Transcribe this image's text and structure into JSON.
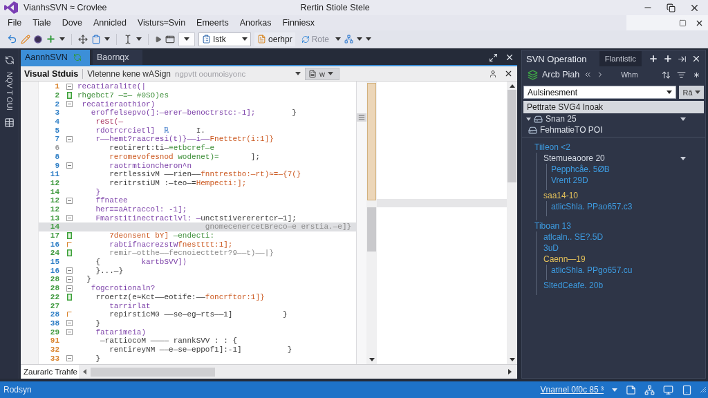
{
  "window": {
    "title": "VianhsSVN ≈ Crovlee",
    "caption": "Rertin Stiole Stele"
  },
  "menu": [
    "File",
    "Tiale",
    "Dove",
    "Annicled",
    "Visturs≈Svin",
    "Emeerts",
    "Anorkas",
    "Finniesx"
  ],
  "toolbar": {
    "combo": "Istk",
    "buttons": [
      {
        "label": "oerhpr",
        "disabled": false
      },
      {
        "label": "Rote",
        "disabled": true
      }
    ]
  },
  "side_strip": {
    "label": "NQV T OUI"
  },
  "document_tabs": [
    {
      "label": "AannhSVN",
      "selected": true
    },
    {
      "label": "Baornqx",
      "selected": false
    }
  ],
  "editor": {
    "title": "Visual Stduis",
    "path": "Vletenne kene wASign",
    "note": "ngpvtt ooumoisyonc",
    "button": "w",
    "bottom_tab": "Zaurarlc Trahfe",
    "lines": [
      {
        "number": "1",
        "color": "#d9822b",
        "kind": "fold",
        "highlighted": false,
        "segments": [
          {
            "text": "recatiaralite(|",
            "kind": "keyword"
          }
        ]
      },
      {
        "number": "2",
        "color": "#3f9a3f",
        "kind": "change",
        "highlighted": false,
        "segments": [
          {
            "text": "rhgebct7 —≡— #0SO)es",
            "kind": "comment"
          }
        ]
      },
      {
        "number": "2",
        "color": "#2f7fc6",
        "kind": "fold",
        "highlighted": false,
        "segments": [
          {
            "text": " recatieraothior)",
            "kind": "keyword"
          }
        ]
      },
      {
        "number": "3",
        "color": "#2f7fc6",
        "kind": "plain",
        "highlighted": false,
        "segments": [
          {
            "text": "   eroffelsepvo(]:—erer—benoctrstc:-1];",
            "kind": "keyword"
          },
          {
            "text": "        }",
            "kind": "plain"
          }
        ]
      },
      {
        "number": "4",
        "color": "#2f7fc6",
        "kind": "plain",
        "highlighted": false,
        "segments": [
          {
            "text": "    reSt(—",
            "kind": "accent"
          }
        ]
      },
      {
        "number": "5",
        "color": "#2f7fc6",
        "kind": "plain",
        "highlighted": false,
        "segments": [
          {
            "text": "    rdotrcrcietl]",
            "kind": "keyword"
          },
          {
            "text": "  ℝ",
            "kind": "symbol"
          },
          {
            "text": "      I.",
            "kind": "plain"
          }
        ]
      },
      {
        "number": "7",
        "color": "#2f7fc6",
        "kind": "fold",
        "highlighted": false,
        "segments": [
          {
            "text": "    r——hemt?raacresi(t)}——i——",
            "kind": "keyword"
          },
          {
            "text": "Fnettetr(i:1]}",
            "kind": "string"
          }
        ]
      },
      {
        "number": "6",
        "color": "#9a9a9a",
        "kind": "plain",
        "highlighted": false,
        "segments": [
          {
            "text": "       reotirert:ti—",
            "kind": "plain"
          },
          {
            "text": "≡etbcref—e",
            "kind": "comment"
          }
        ]
      },
      {
        "number": "8",
        "color": "#2f7fc6",
        "kind": "plain",
        "highlighted": false,
        "segments": [
          {
            "text": "       reromevofesnod",
            "kind": "string"
          },
          {
            "text": " wodenet)=",
            "kind": "comment"
          },
          {
            "text": "       ];",
            "kind": "plain"
          }
        ]
      },
      {
        "number": "9",
        "color": "#2f7fc6",
        "kind": "fold",
        "highlighted": false,
        "segments": [
          {
            "text": "       raotrmtioncheron^n",
            "kind": "keyword"
          }
        ]
      },
      {
        "number": "11",
        "color": "#2f7fc6",
        "kind": "plain",
        "highlighted": false,
        "segments": [
          {
            "text": "       rertlessivM ——rien——",
            "kind": "plain"
          },
          {
            "text": "fnntrestbo:—rt)≈=—{7(}",
            "kind": "string"
          }
        ]
      },
      {
        "number": "12",
        "color": "#3f9a3f",
        "kind": "plain",
        "highlighted": false,
        "segments": [
          {
            "text": "       reritrstiUM :—teo—=",
            "kind": "plain"
          },
          {
            "text": "Hempecti:];",
            "kind": "string"
          }
        ]
      },
      {
        "number": "14",
        "color": "#3f9a3f",
        "kind": "plain",
        "highlighted": false,
        "segments": [
          {
            "text": "    }",
            "kind": "keyword"
          }
        ]
      },
      {
        "number": "12",
        "color": "#3f9a3f",
        "kind": "fold",
        "highlighted": false,
        "segments": [
          {
            "text": "    ffnatee",
            "kind": "keyword"
          }
        ]
      },
      {
        "number": "12",
        "color": "#3f9a3f",
        "kind": "plain",
        "highlighted": false,
        "segments": [
          {
            "text": "    her≡≡aAtraccol: -1];",
            "kind": "keyword"
          }
        ]
      },
      {
        "number": "13",
        "color": "#3f9a3f",
        "kind": "fold",
        "highlighted": false,
        "segments": [
          {
            "text": "    Fmarstitinectractlvl: —",
            "kind": "keyword"
          },
          {
            "text": "unctstivererertcr—1];",
            "kind": "plain"
          }
        ]
      },
      {
        "number": "14",
        "color": "#3f9a3f",
        "kind": "plain",
        "highlighted": true,
        "segments": [
          {
            "text": "                            gnomecenercetBreco—e erstia.—e]}",
            "kind": "dim"
          }
        ]
      },
      {
        "number": "17",
        "color": "#3f9a3f",
        "kind": "change",
        "highlighted": false,
        "segments": [
          {
            "text": "       7deonsent bY]",
            "kind": "string"
          },
          {
            "text": " —endecti:",
            "kind": "comment"
          }
        ]
      },
      {
        "number": "16",
        "color": "#2f7fc6",
        "kind": "mark",
        "highlighted": false,
        "segments": [
          {
            "text": "       rabtifnacrezstW",
            "kind": "keyword"
          },
          {
            "text": "fnestttt:1];",
            "kind": "string"
          }
        ]
      },
      {
        "number": "24",
        "color": "#3f9a3f",
        "kind": "change",
        "highlighted": false,
        "segments": [
          {
            "text": "       remir—otthe——fecnoiecttetr?9——t)——|}",
            "kind": "dim"
          }
        ]
      },
      {
        "number": "15",
        "color": "#2f7fc6",
        "kind": "plain",
        "highlighted": false,
        "segments": [
          {
            "text": "    {",
            "kind": "plain"
          },
          {
            "text": "         kartbSVV]⟩",
            "kind": "keyword"
          }
        ]
      },
      {
        "number": "16",
        "color": "#2f7fc6",
        "kind": "fold",
        "highlighted": false,
        "segments": [
          {
            "text": "    }...—}",
            "kind": "plain"
          }
        ]
      },
      {
        "number": "28",
        "color": "#3f9a3f",
        "kind": "fold",
        "highlighted": false,
        "segments": [
          {
            "text": "  }",
            "kind": "plain"
          }
        ]
      },
      {
        "number": "28",
        "color": "#3f9a3f",
        "kind": "fold",
        "highlighted": false,
        "segments": [
          {
            "text": "   fogcrotionaln?",
            "kind": "keyword"
          }
        ]
      },
      {
        "number": "22",
        "color": "#3f9a3f",
        "kind": "change",
        "highlighted": false,
        "segments": [
          {
            "text": "    rroertz(e≈Kct——eotife:——",
            "kind": "plain"
          },
          {
            "text": "foncrftor:1]}",
            "kind": "string"
          }
        ]
      },
      {
        "number": "27",
        "color": "#3f9a3f",
        "kind": "plain",
        "highlighted": false,
        "segments": [
          {
            "text": "       tarrirlat",
            "kind": "keyword"
          }
        ]
      },
      {
        "number": "28",
        "color": "#2f7fc6",
        "kind": "mark",
        "highlighted": false,
        "segments": [
          {
            "text": "       repirsticM0 ——se—eg—rts——1]           }",
            "kind": "plain"
          }
        ]
      },
      {
        "number": "38",
        "color": "#2f7fc6",
        "kind": "fold",
        "highlighted": false,
        "segments": [
          {
            "text": "    }",
            "kind": "plain"
          }
        ]
      },
      {
        "number": "29",
        "color": "#3f9a3f",
        "kind": "fold",
        "highlighted": false,
        "segments": [
          {
            "text": "    fatarimeia)",
            "kind": "keyword"
          }
        ]
      },
      {
        "number": "91",
        "color": "#d9822b",
        "kind": "plain",
        "highlighted": false,
        "segments": [
          {
            "text": "     —rattiocoM ———— rannkSVV : : {",
            "kind": "plain"
          }
        ]
      },
      {
        "number": "32",
        "color": "#d9822b",
        "kind": "plain",
        "highlighted": false,
        "segments": [
          {
            "text": "       rentireyNM ——e—se—eppof1]:-1]          }",
            "kind": "plain"
          }
        ]
      },
      {
        "number": "33",
        "color": "#d9822b",
        "kind": "fold",
        "highlighted": false,
        "segments": [
          {
            "text": "    }",
            "kind": "plain"
          }
        ]
      }
    ]
  },
  "svn_panel": {
    "title": "SVN Operation",
    "tab": "Flantistic",
    "action": "Arcb Piah",
    "filter_label": "Whm",
    "filter": {
      "value": "Aulsinesment"
    },
    "filter_button": "Rā",
    "header": "Pettrate SVG4 Inoak",
    "tree": [
      {
        "label": "Snan 25",
        "expanded": true,
        "dropdown": true,
        "children": [
          {
            "label": "FehmatieTO POI",
            "dropdown": false
          }
        ]
      }
    ],
    "changes": [
      {
        "label": "Tiileon <2",
        "color": "#3d9be0",
        "dropdown": false,
        "children": [
          {
            "label": "Stemueaoore 20",
            "color": "#d4dae4",
            "dropdown": true,
            "children": [
              {
                "label": "Pepphcåe. 5ØB",
                "color": "#3d9be0",
                "dropdown": false
              },
              {
                "label": "Vrent 29D",
                "color": "#3d9be0",
                "dropdown": false
              }
            ]
          },
          {
            "label": "saa14-10",
            "color": "#e3c05a",
            "dropdown": false,
            "children": [
              {
                "label": "atlicShla. PPao657.c3",
                "color": "#3d9be0",
                "dropdown": false
              }
            ]
          }
        ]
      },
      {
        "label": "Tiboan 13",
        "color": "#3d9be0",
        "dropdown": false,
        "children": [
          {
            "label": "atlcaln.. SE?.5D",
            "color": "#3d9be0",
            "dropdown": false
          },
          {
            "label": "3uD",
            "color": "#3d9be0",
            "dropdown": false
          },
          {
            "label": "Caenn—19",
            "color": "#e3c05a",
            "dropdown": false,
            "children": [
              {
                "label": "atlicShla. PPgo657.cu",
                "color": "#3d9be0",
                "dropdown": false
              }
            ]
          },
          {
            "label": "SltedCeafe. 20b",
            "color": "#3d9be0",
            "dropdown": false
          }
        ]
      }
    ]
  },
  "status_bar": {
    "text": "Rodsyn",
    "branch": "Vnarnel 0f0c 85 ³"
  }
}
